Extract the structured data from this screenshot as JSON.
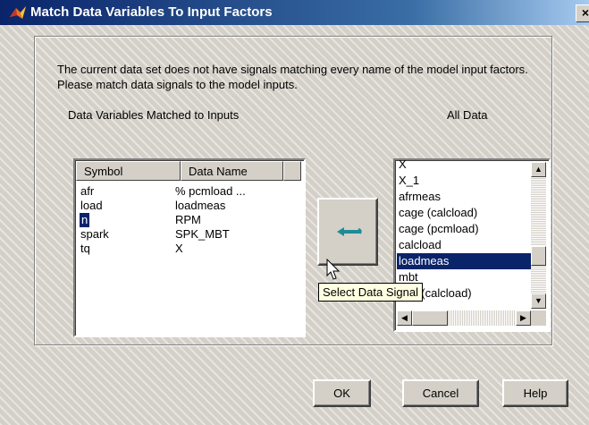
{
  "window": {
    "title": "Match Data Variables To Input Factors",
    "close_glyph": "×"
  },
  "intro": "The current data set does not have signals matching every name of the model input factors. Please match data signals to the model inputs.",
  "labels": {
    "matched": "Data Variables Matched to Inputs",
    "all": "All Data"
  },
  "table": {
    "headers": [
      "Symbol",
      "Data Name"
    ],
    "rows": [
      {
        "symbol": "afr",
        "data_name": "% pcmload ..."
      },
      {
        "symbol": "load",
        "data_name": "loadmeas"
      },
      {
        "symbol": "n",
        "data_name": "RPM",
        "selected": true
      },
      {
        "symbol": "spark",
        "data_name": "SPK_MBT"
      },
      {
        "symbol": "tq",
        "data_name": "X"
      }
    ]
  },
  "all_data": {
    "items": [
      "X",
      "X_1",
      "afrmeas",
      "cage (calcload)",
      "cage (pcmload)",
      "calcload",
      "loadmeas",
      "mbt",
      "mbt (calcload)"
    ],
    "selected": "loadmeas"
  },
  "assign_button": {
    "icon": "left-arrow-icon"
  },
  "tooltip": "Select Data Signal",
  "buttons": {
    "ok": "OK",
    "cancel": "Cancel",
    "help": "Help"
  },
  "colors": {
    "title_start": "#0a246a",
    "title_end": "#a6caf0",
    "selection": "#0a246a",
    "arrow": "#1e8c96",
    "face": "#d4d0c8"
  }
}
